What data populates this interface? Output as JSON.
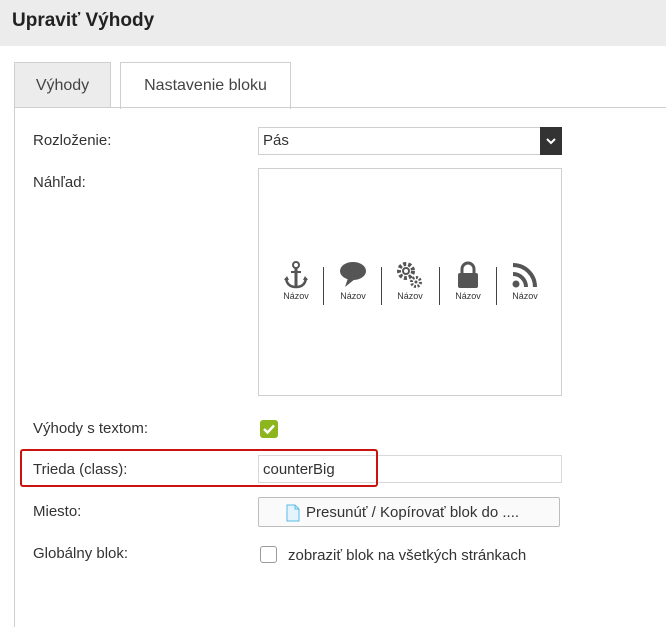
{
  "header": {
    "title": "Upraviť Výhody"
  },
  "tabs": [
    {
      "label": "Výhody",
      "active": false
    },
    {
      "label": "Nastavenie bloku",
      "active": true
    }
  ],
  "form": {
    "layout": {
      "label": "Rozloženie:",
      "value": "Pás"
    },
    "preview": {
      "label": "Náhľad:",
      "items": [
        {
          "icon": "anchor-icon",
          "caption": "Názov"
        },
        {
          "icon": "speech-bubble-icon",
          "caption": "Názov"
        },
        {
          "icon": "gears-icon",
          "caption": "Názov"
        },
        {
          "icon": "lock-icon",
          "caption": "Názov"
        },
        {
          "icon": "rss-icon",
          "caption": "Názov"
        }
      ]
    },
    "with_text": {
      "label": "Výhody s textom:",
      "checked": true
    },
    "class": {
      "label": "Trieda (class):",
      "value": "counterBig"
    },
    "place": {
      "label": "Miesto:",
      "button": "Presunúť / Kopírovať blok do ...."
    },
    "global": {
      "label": "Globálny blok:",
      "checkbox_label": "zobraziť blok na všetkých stránkach",
      "checked": false
    }
  },
  "colors": {
    "accent_green": "#8cb51e",
    "highlight_red": "#cc1111"
  }
}
